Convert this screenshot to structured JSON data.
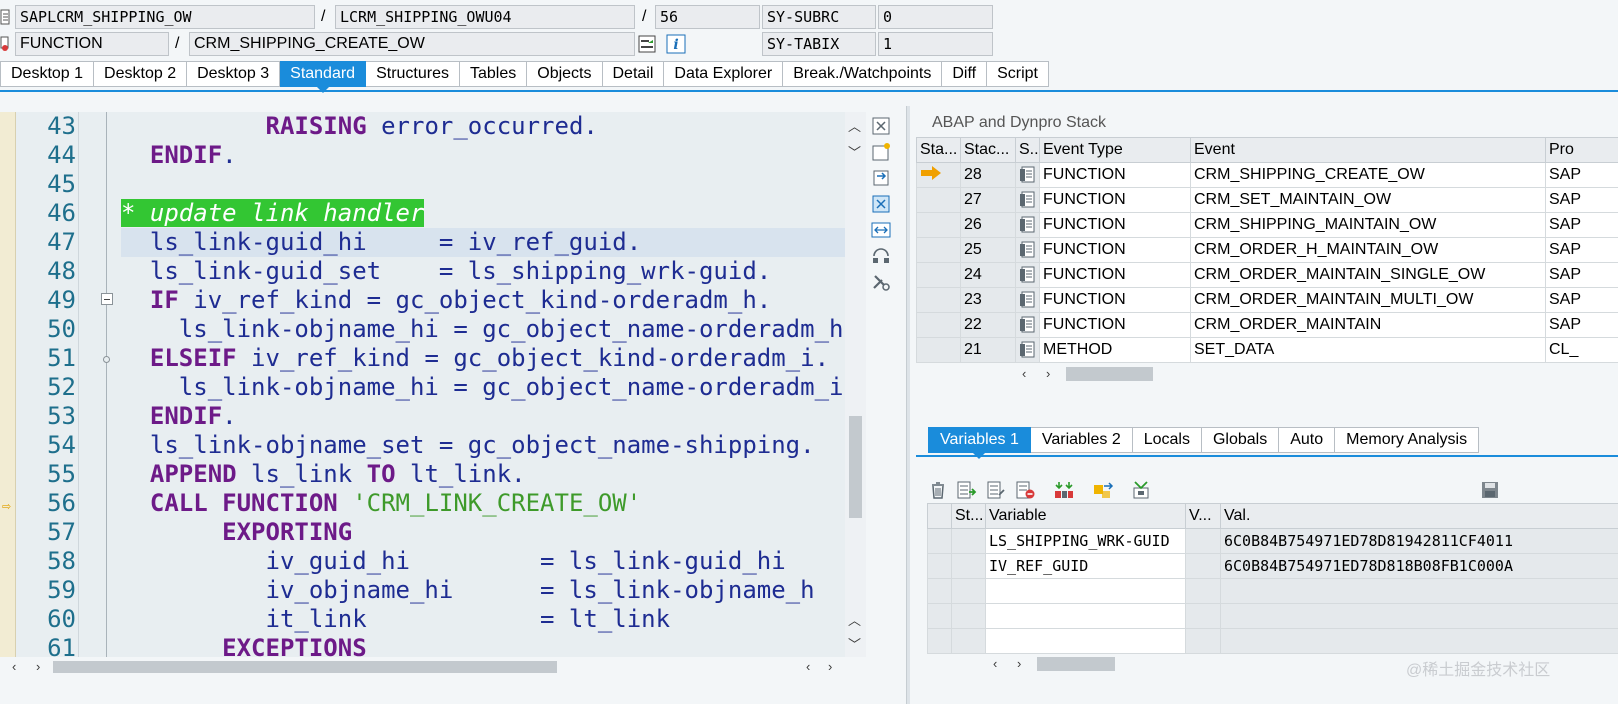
{
  "header": {
    "program": "SAPLCRM_SHIPPING_OW",
    "include": "LCRM_SHIPPING_OWU04",
    "line": "56",
    "subrc_label": "SY-SUBRC",
    "subrc_value": "0",
    "event_type": "FUNCTION",
    "event_name": "CRM_SHIPPING_CREATE_OW",
    "tabix_label": "SY-TABIX",
    "tabix_value": "1",
    "sep1": "/",
    "sep2": "/",
    "sep3": "/"
  },
  "tabs": [
    "Desktop 1",
    "Desktop 2",
    "Desktop 3",
    "Standard",
    "Structures",
    "Tables",
    "Objects",
    "Detail",
    "Data Explorer",
    "Break./Watchpoints",
    "Diff",
    "Script"
  ],
  "active_tab": "Standard",
  "editor": {
    "current_line": "47",
    "breakpoint_line": "56",
    "lines": [
      {
        "n": "43",
        "segs": [
          {
            "t": "          "
          },
          {
            "t": "RAISING",
            "c": "kw"
          },
          {
            "t": " error_occurred.",
            "c": "fn"
          }
        ]
      },
      {
        "n": "44",
        "segs": [
          {
            "t": "  "
          },
          {
            "t": "ENDIF",
            "c": "kw"
          },
          {
            "t": ".",
            "c": "fn"
          }
        ]
      },
      {
        "n": "45",
        "segs": []
      },
      {
        "n": "46",
        "segs": [
          {
            "t": "* update link handler",
            "c": "cmt"
          }
        ]
      },
      {
        "n": "47",
        "segs": [
          {
            "t": "  ls_link-guid_hi     = iv_ref_guid.",
            "c": "fn"
          }
        ]
      },
      {
        "n": "48",
        "segs": [
          {
            "t": "  ls_link-guid_set    = ls_shipping_wrk-guid.",
            "c": "fn"
          }
        ]
      },
      {
        "n": "49",
        "segs": [
          {
            "t": "  "
          },
          {
            "t": "IF",
            "c": "kw"
          },
          {
            "t": " iv_ref_kind = gc_object_kind-orderadm_h.",
            "c": "fn"
          }
        ]
      },
      {
        "n": "50",
        "segs": [
          {
            "t": "    ls_link-objname_hi = gc_object_name-orderadm_h",
            "c": "fn"
          }
        ]
      },
      {
        "n": "51",
        "segs": [
          {
            "t": "  "
          },
          {
            "t": "ELSEIF",
            "c": "kw"
          },
          {
            "t": " iv_ref_kind = gc_object_kind-orderadm_i.",
            "c": "fn"
          }
        ]
      },
      {
        "n": "52",
        "segs": [
          {
            "t": "    ls_link-objname_hi = gc_object_name-orderadm_i",
            "c": "fn"
          }
        ]
      },
      {
        "n": "53",
        "segs": [
          {
            "t": "  "
          },
          {
            "t": "ENDIF",
            "c": "kw"
          },
          {
            "t": ".",
            "c": "fn"
          }
        ]
      },
      {
        "n": "54",
        "segs": [
          {
            "t": "  ls_link-objname_set = gc_object_name-shipping.",
            "c": "fn"
          }
        ]
      },
      {
        "n": "55",
        "segs": [
          {
            "t": "  "
          },
          {
            "t": "APPEND",
            "c": "kw"
          },
          {
            "t": " ls_link ",
            "c": "fn"
          },
          {
            "t": "TO",
            "c": "kw"
          },
          {
            "t": " lt_link.",
            "c": "fn"
          }
        ]
      },
      {
        "n": "56",
        "segs": [
          {
            "t": "  "
          },
          {
            "t": "CALL FUNCTION",
            "c": "kw"
          },
          {
            "t": " "
          },
          {
            "t": "'CRM_LINK_CREATE_OW'",
            "c": "str"
          }
        ]
      },
      {
        "n": "57",
        "segs": [
          {
            "t": "       "
          },
          {
            "t": "EXPORTING",
            "c": "kw"
          }
        ]
      },
      {
        "n": "58",
        "segs": [
          {
            "t": "          iv_guid_hi         = ls_link-guid_hi",
            "c": "fn"
          }
        ]
      },
      {
        "n": "59",
        "segs": [
          {
            "t": "          iv_objname_hi      = ls_link-objname_h",
            "c": "fn"
          }
        ]
      },
      {
        "n": "60",
        "segs": [
          {
            "t": "          it_link            = lt_link",
            "c": "fn"
          }
        ]
      },
      {
        "n": "61",
        "segs": [
          {
            "t": "       "
          },
          {
            "t": "EXCEPTIONS",
            "c": "kw"
          }
        ]
      }
    ]
  },
  "stack": {
    "title": "ABAP and Dynpro Stack",
    "columns": [
      "Sta...",
      "Stac...",
      "S..",
      "Event Type",
      "Event",
      "Pro"
    ],
    "rows": [
      {
        "level": "28",
        "type": "FUNCTION",
        "event": "CRM_SHIPPING_CREATE_OW",
        "prog": "SAP",
        "current": true
      },
      {
        "level": "27",
        "type": "FUNCTION",
        "event": "CRM_SET_MAINTAIN_OW",
        "prog": "SAP"
      },
      {
        "level": "26",
        "type": "FUNCTION",
        "event": "CRM_SHIPPING_MAINTAIN_OW",
        "prog": "SAP"
      },
      {
        "level": "25",
        "type": "FUNCTION",
        "event": "CRM_ORDER_H_MAINTAIN_OW",
        "prog": "SAP"
      },
      {
        "level": "24",
        "type": "FUNCTION",
        "event": "CRM_ORDER_MAINTAIN_SINGLE_OW",
        "prog": "SAP"
      },
      {
        "level": "23",
        "type": "FUNCTION",
        "event": "CRM_ORDER_MAINTAIN_MULTI_OW",
        "prog": "SAP"
      },
      {
        "level": "22",
        "type": "FUNCTION",
        "event": "CRM_ORDER_MAINTAIN",
        "prog": "SAP"
      },
      {
        "level": "21",
        "type": "METHOD",
        "event": "SET_DATA",
        "prog": "CL_"
      }
    ]
  },
  "variables": {
    "tabs": [
      "Variables 1",
      "Variables 2",
      "Locals",
      "Globals",
      "Auto",
      "Memory Analysis"
    ],
    "active_tab": "Variables 1",
    "columns": [
      "St...",
      "Variable",
      "V...",
      "Val."
    ],
    "rows": [
      {
        "name": "LS_SHIPPING_WRK-GUID",
        "value": "6C0B84B754971ED78D81942811CF4011"
      },
      {
        "name": "IV_REF_GUID",
        "value": "6C0B84B754971ED78D818B08FB1C000A"
      },
      {
        "name": "",
        "value": ""
      },
      {
        "name": "",
        "value": ""
      },
      {
        "name": "",
        "value": ""
      }
    ],
    "toolbar_icons": [
      "delete-icon",
      "insert-variable-icon",
      "copy-variable-icon",
      "remove-variable-icon",
      "transfer-icon",
      "change-icon",
      "import-icon",
      "save-icon"
    ]
  },
  "watermark": "@稀土掘金技术社区",
  "colors": {
    "accent": "#1a8cdb",
    "keyword": "#6d1a88",
    "identifier": "#1e2c92",
    "string": "#3e9a2a",
    "comment_bg": "#33c633",
    "stack_pointer": "#f0a000"
  }
}
